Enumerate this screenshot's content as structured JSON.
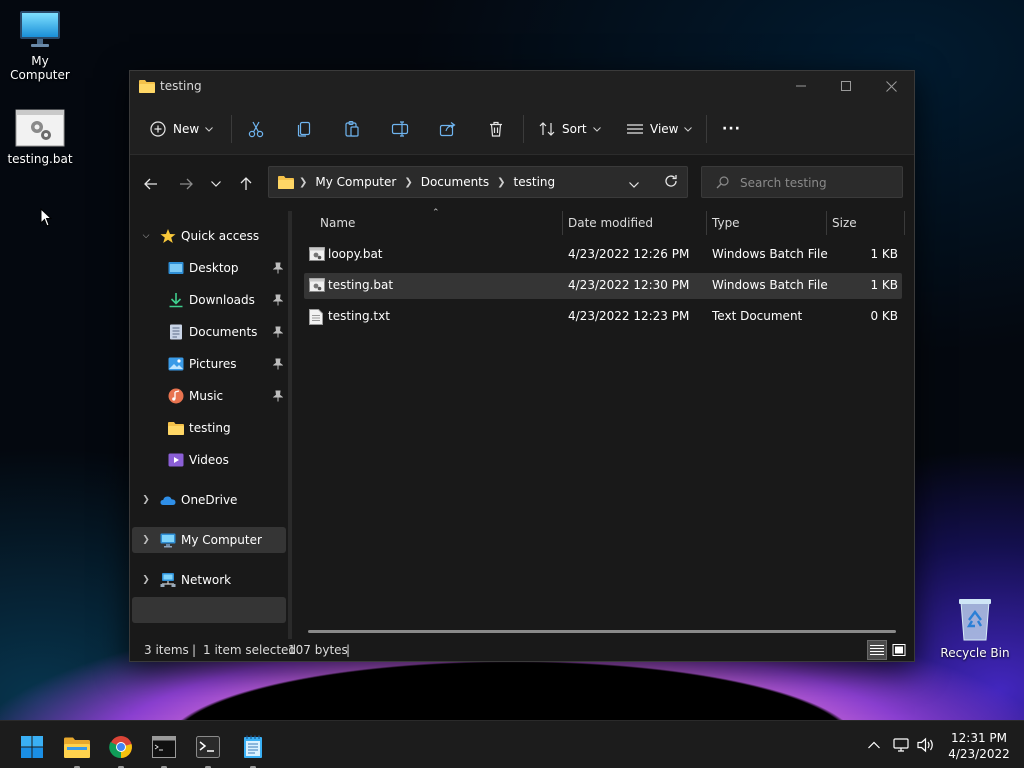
{
  "desktop": {
    "icons": [
      {
        "label": "My Computer",
        "icon": "monitor-icon"
      },
      {
        "label": "testing.bat",
        "icon": "batch-file-icon"
      },
      {
        "label": "Recycle Bin",
        "icon": "recycle-bin-icon"
      }
    ]
  },
  "window": {
    "title": "testing",
    "toolbar": {
      "new_label": "New",
      "sort_label": "Sort",
      "view_label": "View",
      "more_label": "···"
    },
    "address": {
      "crumbs": [
        "My Computer",
        "Documents",
        "testing"
      ]
    },
    "search": {
      "placeholder": "Search testing"
    },
    "sidebar": {
      "quick_access": "Quick access",
      "items": [
        {
          "label": "Desktop",
          "icon": "desktop-folder-icon",
          "pinned": true
        },
        {
          "label": "Downloads",
          "icon": "downloads-icon",
          "pinned": true
        },
        {
          "label": "Documents",
          "icon": "documents-icon",
          "pinned": true
        },
        {
          "label": "Pictures",
          "icon": "pictures-icon",
          "pinned": true
        },
        {
          "label": "Music",
          "icon": "music-icon",
          "pinned": true
        },
        {
          "label": "testing",
          "icon": "folder-icon",
          "pinned": false
        },
        {
          "label": "Videos",
          "icon": "videos-icon",
          "pinned": false
        }
      ],
      "onedrive": "OneDrive",
      "my_computer": "My Computer",
      "network": "Network"
    },
    "columns": {
      "name": "Name",
      "date": "Date modified",
      "type": "Type",
      "size": "Size"
    },
    "files": [
      {
        "name": "loopy.bat",
        "date": "4/23/2022 12:26 PM",
        "type": "Windows Batch File",
        "size": "1 KB",
        "selected": false
      },
      {
        "name": "testing.bat",
        "date": "4/23/2022 12:30 PM",
        "type": "Windows Batch File",
        "size": "1 KB",
        "selected": true
      },
      {
        "name": "testing.txt",
        "date": "4/23/2022 12:23 PM",
        "type": "Text Document",
        "size": "0 KB",
        "selected": false
      }
    ],
    "status": {
      "items": "3 items",
      "selected": "1 item selected",
      "bytes": "107 bytes",
      "sep": "|"
    }
  },
  "taskbar": {
    "apps": [
      "start-icon",
      "file-explorer-icon",
      "chrome-icon",
      "command-prompt-icon",
      "terminal-icon",
      "notepad-icon"
    ],
    "clock": {
      "time": "12:31 PM",
      "date": "4/23/2022"
    }
  },
  "colors": {
    "window_bg": "#191919",
    "toolbar_bg": "#202020",
    "selection": "#353535",
    "folder_yellow": "#f4c14a",
    "accent_blue": "#3b8eea"
  }
}
